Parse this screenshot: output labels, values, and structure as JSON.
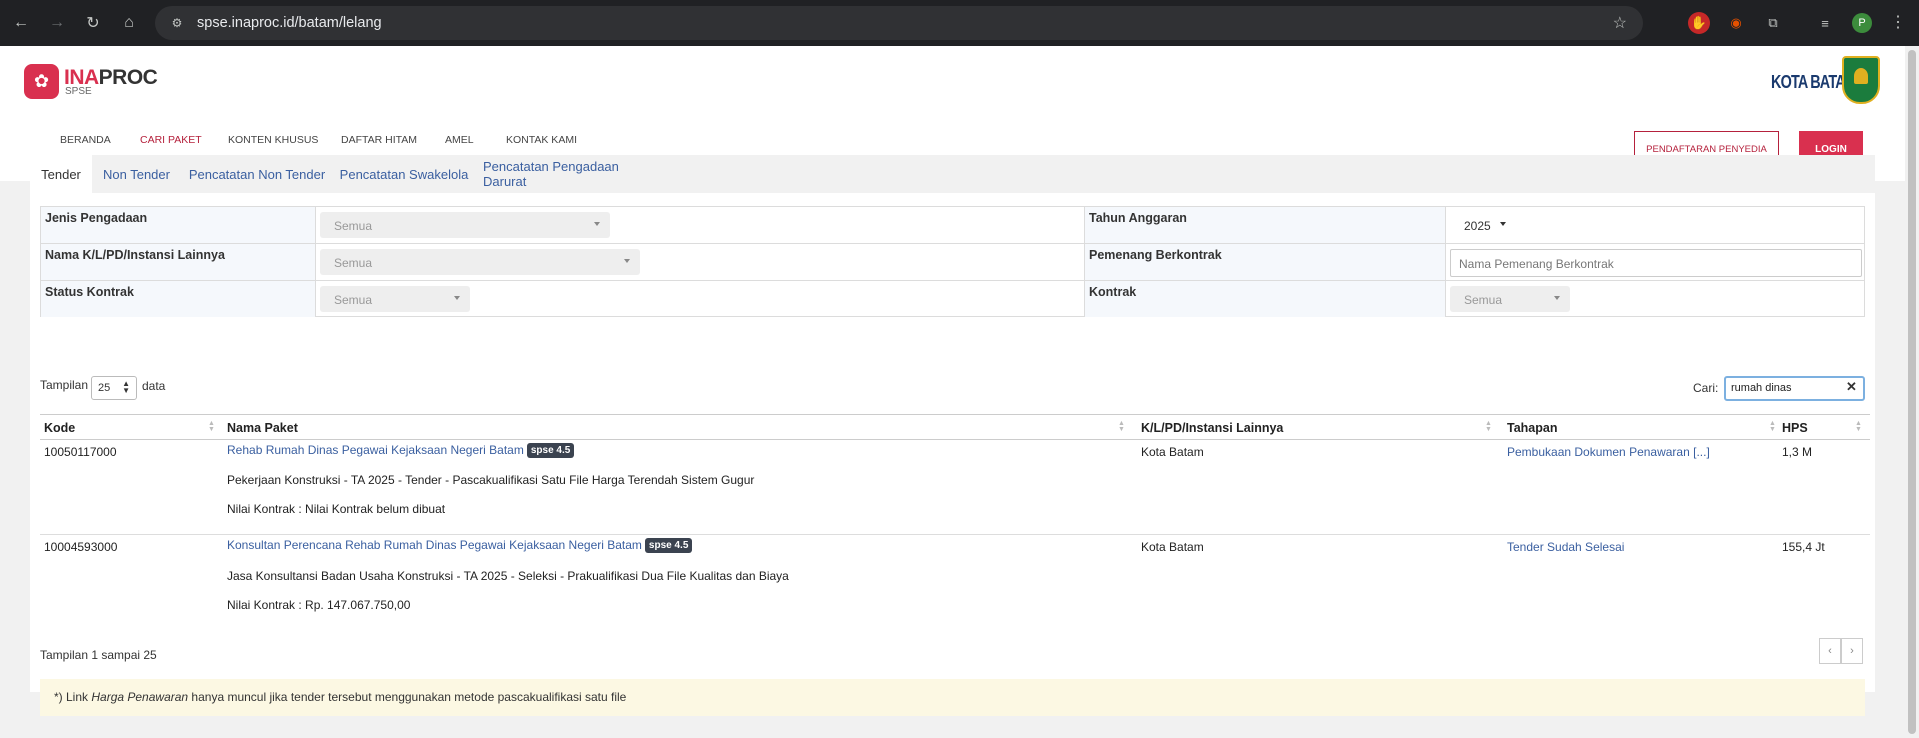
{
  "browser": {
    "url": "spse.inaproc.id/batam/lelang",
    "profile_initial": "P"
  },
  "header": {
    "logo_main_a": "INA",
    "logo_main_b": "PROC",
    "logo_sub": "SPSE",
    "city": "KOTA BATAM",
    "nav": [
      "BERANDA",
      "CARI PAKET",
      "KONTEN KHUSUS",
      "DAFTAR HITAM",
      "AMEL",
      "KONTAK KAMI"
    ],
    "active_nav": "CARI PAKET",
    "btn_register": "PENDAFTARAN PENYEDIA",
    "btn_login": "LOGIN",
    "accent": "#d9304f"
  },
  "tabs": [
    "Tender",
    "Non Tender",
    "Pencatatan Non Tender",
    "Pencatatan Swakelola",
    "Pencatatan Pengadaan Darurat"
  ],
  "filters": {
    "jenis_label": "Jenis Pengadaan",
    "jenis_value": "Semua",
    "tahun_label": "Tahun Anggaran",
    "tahun_value": "2025",
    "instansi_label": "Nama K/L/PD/Instansi Lainnya",
    "instansi_value": "Semua",
    "pemenang_label": "Pemenang Berkontrak",
    "pemenang_placeholder": "Nama Pemenang Berkontrak",
    "status_label": "Status Kontrak",
    "status_value": "Semua",
    "kontrak_label": "Kontrak",
    "kontrak_value": "Semua"
  },
  "table_controls": {
    "show_label": "Tampilan",
    "page_size": "25",
    "data_label": "data",
    "search_label": "Cari:",
    "search_value": "rumah dinas"
  },
  "table": {
    "headers": [
      "Kode",
      "Nama Paket",
      "K/L/PD/Instansi Lainnya",
      "Tahapan",
      "HPS"
    ],
    "rows": [
      {
        "kode": "10050117000",
        "nama": "Rehab Rumah Dinas Pegawai Kejaksaan Negeri Batam",
        "badge": "spse 4.5",
        "desc": "Pekerjaan Konstruksi - TA 2025 - Tender - Pascakualifikasi Satu File Harga Terendah Sistem Gugur",
        "nilai": "Nilai Kontrak : Nilai Kontrak belum dibuat",
        "instansi": "Kota Batam",
        "tahapan": "Pembukaan Dokumen Penawaran [...]",
        "hps": "1,3 M"
      },
      {
        "kode": "10004593000",
        "nama": "Konsultan Perencana Rehab Rumah Dinas Pegawai Kejaksaan Negeri Batam",
        "badge": "spse 4.5",
        "desc": "Jasa Konsultansi Badan Usaha Konstruksi - TA 2025 - Seleksi - Prakualifikasi Dua File Kualitas dan Biaya",
        "nilai": "Nilai Kontrak : Rp. 147.067.750,00",
        "instansi": "Kota Batam",
        "tahapan": "Tender Sudah Selesai",
        "hps": "155,4 Jt"
      }
    ]
  },
  "footer": {
    "info": "Tampilan 1 sampai 25",
    "prev": "‹",
    "next": "›",
    "note_a": "*) Link ",
    "note_em": "Harga Penawaran",
    "note_b": " hanya muncul jika tender tersebut menggunakan metode pascakualifikasi satu file"
  }
}
